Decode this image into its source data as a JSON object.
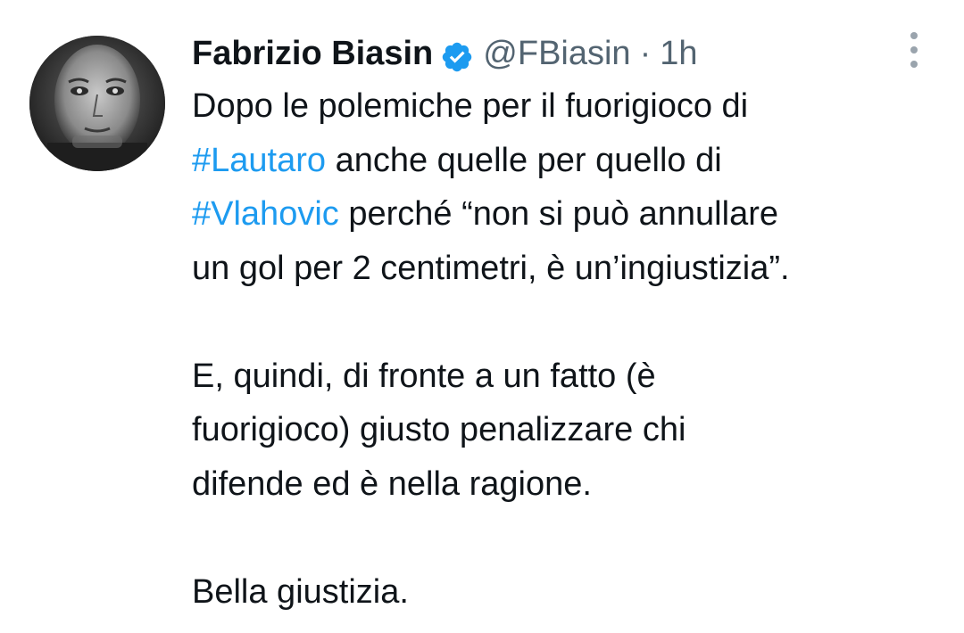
{
  "tweet": {
    "author": {
      "display_name": "Fabrizio Biasin",
      "verified": true,
      "verified_icon": "verified-badge-icon",
      "handle": "@FBiasin",
      "separator": "·",
      "time": "1h",
      "avatar": "profile-photo"
    },
    "menu_icon": "more-options-icon",
    "paragraphs": [
      {
        "lines": [
          {
            "parts": [
              {
                "text": "Dopo le polemiche per il fuorigioco di",
                "hashtag": false
              }
            ]
          },
          {
            "parts": [
              {
                "text": "#Lautaro",
                "hashtag": true
              },
              {
                "text": " anche quelle per quello di",
                "hashtag": false
              }
            ]
          },
          {
            "parts": [
              {
                "text": "#Vlahovic",
                "hashtag": true
              },
              {
                "text": " perché “non si può annullare",
                "hashtag": false
              }
            ]
          },
          {
            "parts": [
              {
                "text": "un gol per 2 centimetri, è un’ingiustizia”.",
                "hashtag": false
              }
            ]
          }
        ]
      },
      {
        "lines": [
          {
            "parts": [
              {
                "text": "E, quindi, di fronte a un fatto (è",
                "hashtag": false
              }
            ]
          },
          {
            "parts": [
              {
                "text": "fuorigioco) giusto penalizzare chi",
                "hashtag": false
              }
            ]
          },
          {
            "parts": [
              {
                "text": "difende ed è nella ragione.",
                "hashtag": false
              }
            ]
          }
        ]
      },
      {
        "lines": [
          {
            "parts": [
              {
                "text": "Bella giustizia.",
                "hashtag": false
              }
            ]
          }
        ]
      }
    ],
    "colors": {
      "text": "#0f1419",
      "secondary": "#536471",
      "hashtag": "#1d9bf0",
      "verified": "#1d9bf0"
    }
  }
}
